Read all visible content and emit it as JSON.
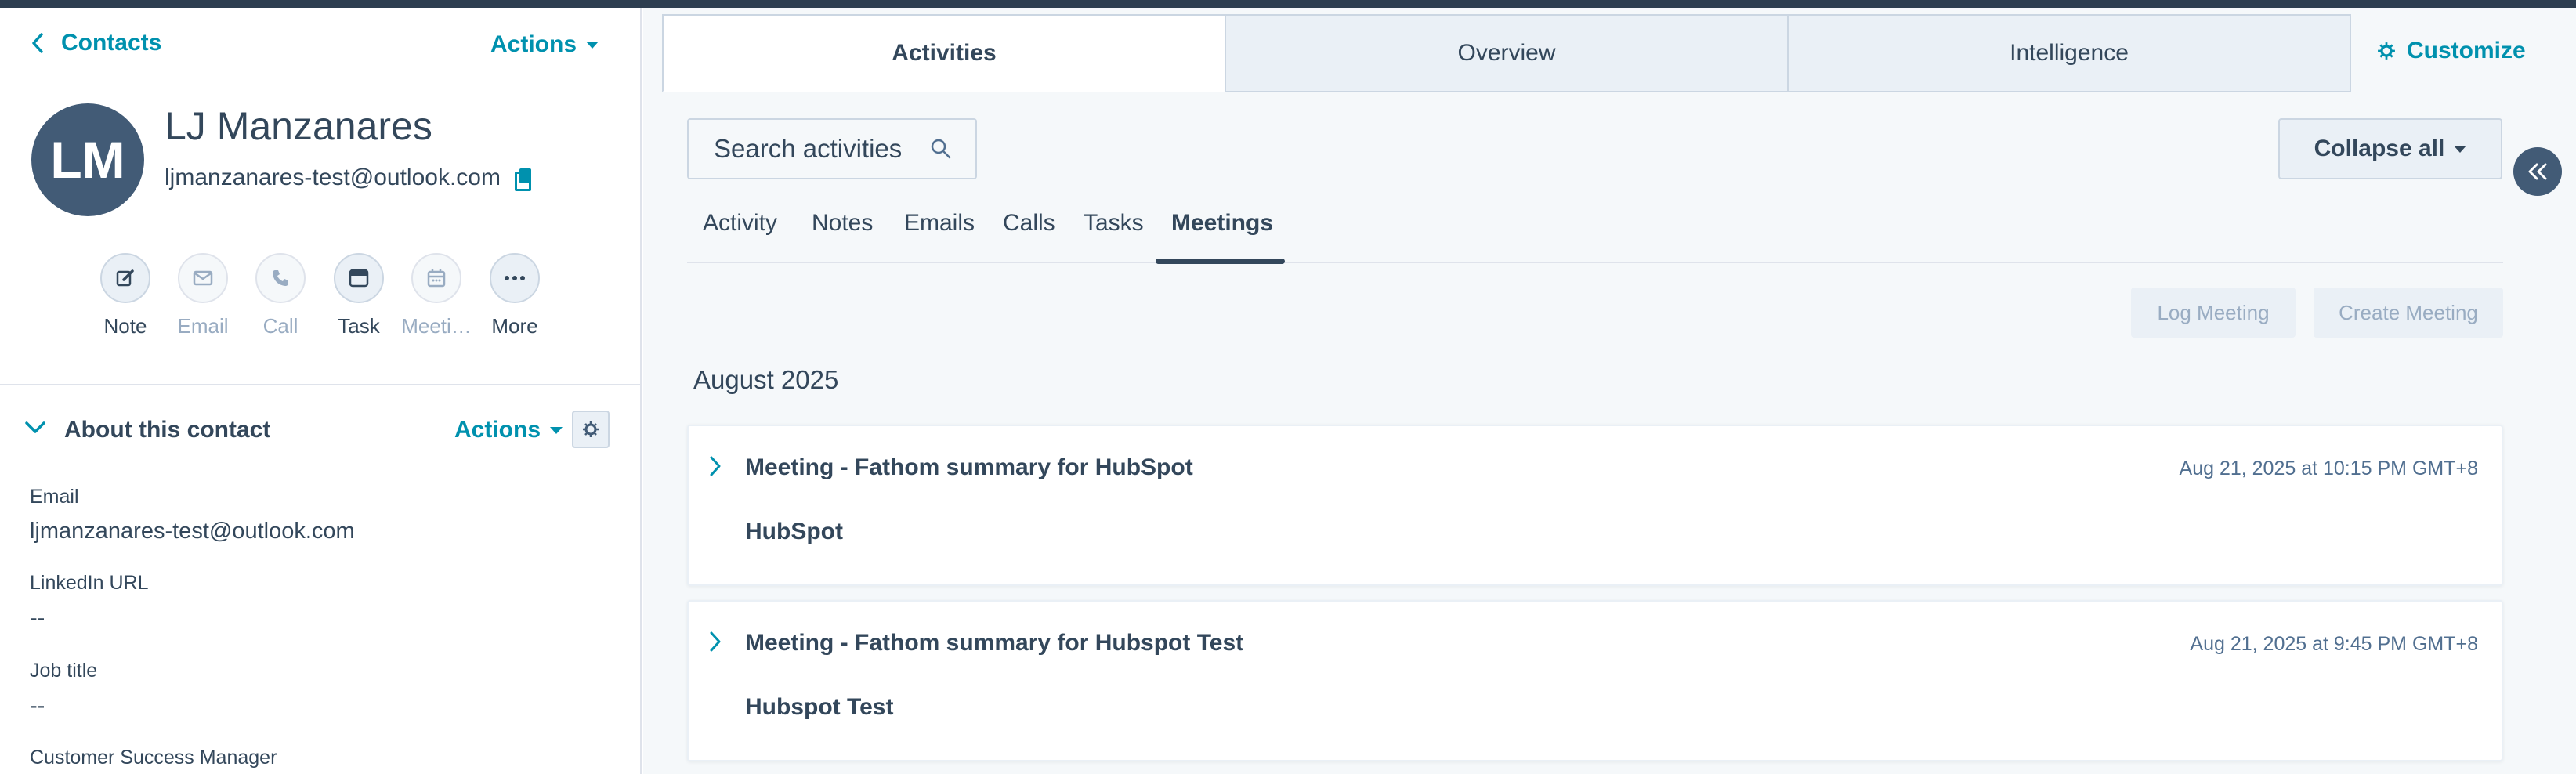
{
  "colors": {
    "accent": "#0091ae",
    "text": "#33475b",
    "avatar_bg": "#425b76",
    "topbar": "#2d3e50",
    "disabled": "#99acc2"
  },
  "left": {
    "back_label": "Contacts",
    "actions_label": "Actions",
    "contact": {
      "initials": "LM",
      "name": "LJ Manzanares",
      "email": "ljmanzanares-test@outlook.com"
    },
    "quick_actions": [
      {
        "label": "Note",
        "icon": "edit-icon",
        "enabled": true
      },
      {
        "label": "Email",
        "icon": "email-icon",
        "enabled": false
      },
      {
        "label": "Call",
        "icon": "phone-icon",
        "enabled": false
      },
      {
        "label": "Task",
        "icon": "task-icon",
        "enabled": true
      },
      {
        "label": "Meeti…",
        "icon": "calendar-icon",
        "enabled": false
      },
      {
        "label": "More",
        "icon": "more-icon",
        "enabled": true
      }
    ],
    "about": {
      "title": "About this contact",
      "actions_label": "Actions",
      "properties": [
        {
          "label": "Email",
          "value": "ljmanzanares-test@outlook.com"
        },
        {
          "label": "LinkedIn URL",
          "value": "--"
        },
        {
          "label": "Job title",
          "value": "--"
        },
        {
          "label": "Customer Success Manager",
          "value": ""
        }
      ]
    }
  },
  "main": {
    "tabs": [
      {
        "label": "Activities",
        "active": true
      },
      {
        "label": "Overview",
        "active": false
      },
      {
        "label": "Intelligence",
        "active": false
      }
    ],
    "customize_label": "Customize",
    "search_placeholder": "Search activities",
    "collapse_label": "Collapse all",
    "subtabs": [
      {
        "label": "Activity",
        "active": false
      },
      {
        "label": "Notes",
        "active": false
      },
      {
        "label": "Emails",
        "active": false
      },
      {
        "label": "Calls",
        "active": false
      },
      {
        "label": "Tasks",
        "active": false
      },
      {
        "label": "Meetings",
        "active": true
      }
    ],
    "log_meeting_label": "Log Meeting",
    "create_meeting_label": "Create Meeting",
    "month": "August 2025",
    "meetings": [
      {
        "title": "Meeting - Fathom summary for HubSpot",
        "date": "Aug 21, 2025 at 10:15 PM GMT+8",
        "subtitle": "HubSpot"
      },
      {
        "title": "Meeting - Fathom summary for Hubspot Test",
        "date": "Aug 21, 2025 at 9:45 PM GMT+8",
        "subtitle": "Hubspot Test"
      }
    ]
  }
}
